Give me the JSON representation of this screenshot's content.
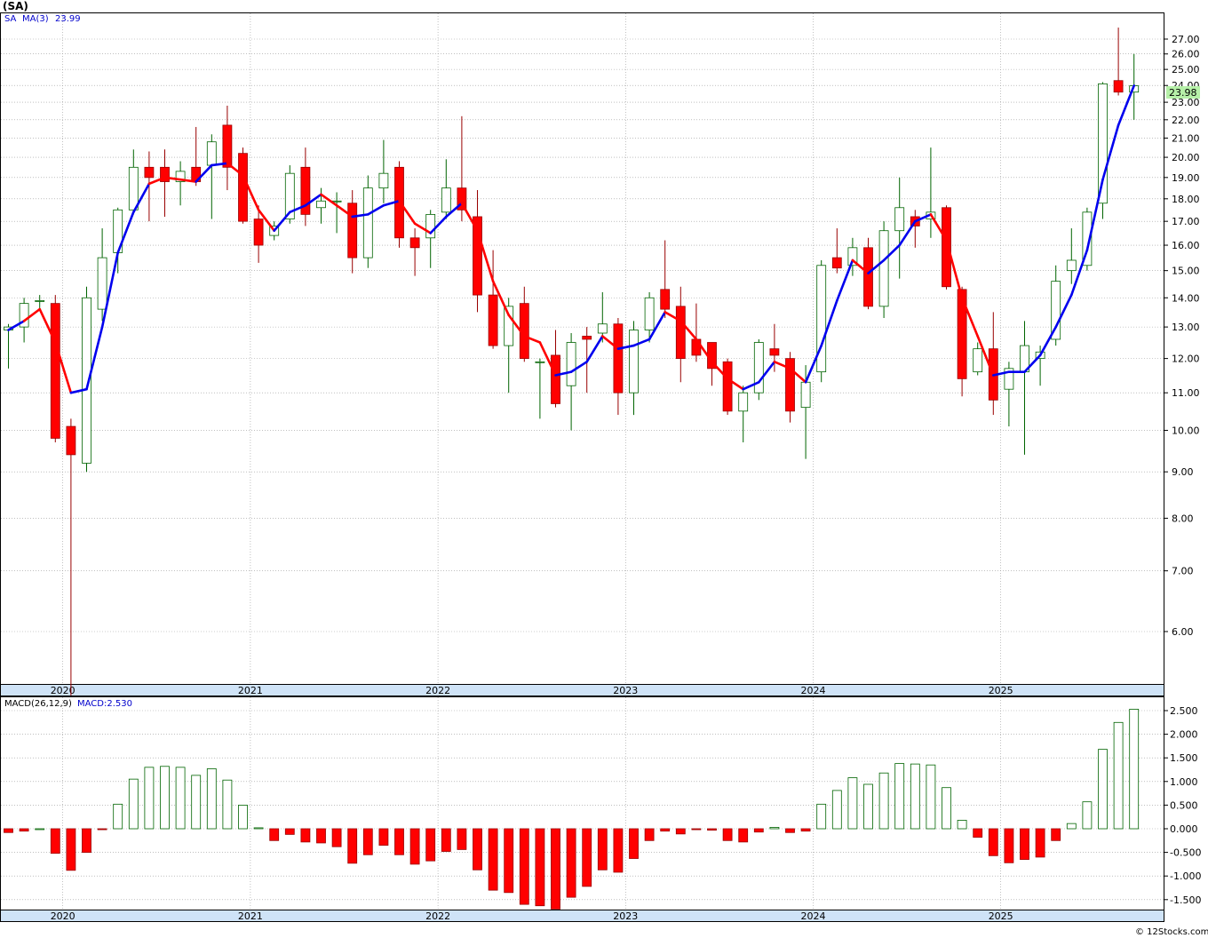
{
  "chart_title": "(SA)",
  "price_legend": {
    "symbol": "SA",
    "ma_label": "MA(3)",
    "ma_value": "23.99"
  },
  "last_price_label": "23.98",
  "macd_legend": {
    "label": "MACD(26,12,9)",
    "value_label": "MACD:2.530"
  },
  "footer": "© 12Stocks.com",
  "colors": {
    "up": "#006400",
    "down": "#ff0000",
    "ma_up": "#0000ee",
    "ma_down": "#ff0000",
    "axis_band": "#cfe3f7",
    "last_price_bg": "#b6f0a8",
    "grid": "#999999"
  },
  "chart_data": [
    {
      "type": "candlestick",
      "ylabel": "",
      "y_scale": "log",
      "y_ticks": [
        "6.00",
        "7.00",
        "8.00",
        "9.00",
        "10.00",
        "11.00",
        "12.00",
        "13.00",
        "14.00",
        "15.00",
        "16.00",
        "17.00",
        "18.00",
        "19.00",
        "20.00",
        "21.00",
        "22.00",
        "23.00",
        "24.00",
        "25.00",
        "26.00",
        "27.00"
      ],
      "x_ticks": [
        "2020",
        "2021",
        "2022",
        "2023",
        "2024",
        "2025"
      ],
      "candles": [
        {
          "o": 12.9,
          "h": 13.1,
          "l": 11.7,
          "c": 13.0
        },
        {
          "o": 13.0,
          "h": 14.0,
          "l": 12.5,
          "c": 13.8
        },
        {
          "o": 13.9,
          "h": 14.1,
          "l": 13.6,
          "c": 13.9
        },
        {
          "o": 13.8,
          "h": 14.1,
          "l": 9.7,
          "c": 9.8
        },
        {
          "o": 10.1,
          "h": 10.3,
          "l": 5.1,
          "c": 9.4
        },
        {
          "o": 9.2,
          "h": 14.4,
          "l": 9.0,
          "c": 14.0
        },
        {
          "o": 13.6,
          "h": 16.7,
          "l": 13.2,
          "c": 15.5
        },
        {
          "o": 15.7,
          "h": 17.6,
          "l": 14.9,
          "c": 17.5
        },
        {
          "o": 17.5,
          "h": 20.4,
          "l": 17.3,
          "c": 19.5
        },
        {
          "o": 19.5,
          "h": 20.3,
          "l": 17.0,
          "c": 19.0
        },
        {
          "o": 19.5,
          "h": 20.4,
          "l": 17.2,
          "c": 18.8
        },
        {
          "o": 18.8,
          "h": 19.8,
          "l": 17.7,
          "c": 19.3
        },
        {
          "o": 19.5,
          "h": 21.6,
          "l": 18.6,
          "c": 18.8
        },
        {
          "o": 19.6,
          "h": 21.2,
          "l": 17.1,
          "c": 20.8
        },
        {
          "o": 21.7,
          "h": 22.8,
          "l": 18.4,
          "c": 19.5
        },
        {
          "o": 20.2,
          "h": 20.5,
          "l": 16.9,
          "c": 17.0
        },
        {
          "o": 17.1,
          "h": 17.7,
          "l": 15.3,
          "c": 16.0
        },
        {
          "o": 16.4,
          "h": 17.0,
          "l": 16.2,
          "c": 16.8
        },
        {
          "o": 17.1,
          "h": 19.6,
          "l": 16.9,
          "c": 19.2
        },
        {
          "o": 19.5,
          "h": 20.5,
          "l": 16.8,
          "c": 17.3
        },
        {
          "o": 17.6,
          "h": 18.5,
          "l": 16.9,
          "c": 17.9
        },
        {
          "o": 17.9,
          "h": 18.3,
          "l": 16.5,
          "c": 17.9
        },
        {
          "o": 17.8,
          "h": 18.4,
          "l": 14.9,
          "c": 15.5
        },
        {
          "o": 15.5,
          "h": 19.1,
          "l": 15.1,
          "c": 18.5
        },
        {
          "o": 18.5,
          "h": 20.9,
          "l": 17.8,
          "c": 19.2
        },
        {
          "o": 19.5,
          "h": 19.8,
          "l": 15.9,
          "c": 16.3
        },
        {
          "o": 16.3,
          "h": 16.7,
          "l": 14.8,
          "c": 15.9
        },
        {
          "o": 16.3,
          "h": 17.5,
          "l": 15.1,
          "c": 17.3
        },
        {
          "o": 17.4,
          "h": 19.9,
          "l": 17.1,
          "c": 18.5
        },
        {
          "o": 18.5,
          "h": 22.2,
          "l": 17.0,
          "c": 17.5
        },
        {
          "o": 17.2,
          "h": 18.4,
          "l": 13.5,
          "c": 14.1
        },
        {
          "o": 14.1,
          "h": 15.8,
          "l": 12.3,
          "c": 12.4
        },
        {
          "o": 12.4,
          "h": 14.0,
          "l": 11.0,
          "c": 13.7
        },
        {
          "o": 13.8,
          "h": 14.4,
          "l": 11.9,
          "c": 12.0
        },
        {
          "o": 11.9,
          "h": 12.0,
          "l": 10.3,
          "c": 11.9
        },
        {
          "o": 12.1,
          "h": 12.9,
          "l": 10.6,
          "c": 10.7
        },
        {
          "o": 11.2,
          "h": 12.8,
          "l": 10.0,
          "c": 12.5
        },
        {
          "o": 12.7,
          "h": 13.0,
          "l": 11.0,
          "c": 12.6
        },
        {
          "o": 12.8,
          "h": 14.2,
          "l": 12.5,
          "c": 13.1
        },
        {
          "o": 13.1,
          "h": 13.3,
          "l": 10.4,
          "c": 11.0
        },
        {
          "o": 11.0,
          "h": 13.2,
          "l": 10.4,
          "c": 12.9
        },
        {
          "o": 12.9,
          "h": 14.2,
          "l": 12.5,
          "c": 14.0
        },
        {
          "o": 14.3,
          "h": 16.2,
          "l": 13.3,
          "c": 13.6
        },
        {
          "o": 13.7,
          "h": 14.4,
          "l": 11.3,
          "c": 12.0
        },
        {
          "o": 12.6,
          "h": 13.8,
          "l": 11.9,
          "c": 12.1
        },
        {
          "o": 12.5,
          "h": 12.5,
          "l": 11.2,
          "c": 11.7
        },
        {
          "o": 11.9,
          "h": 12.0,
          "l": 10.4,
          "c": 10.5
        },
        {
          "o": 10.5,
          "h": 11.2,
          "l": 9.7,
          "c": 11.0
        },
        {
          "o": 11.0,
          "h": 12.6,
          "l": 10.8,
          "c": 12.5
        },
        {
          "o": 12.3,
          "h": 13.1,
          "l": 11.6,
          "c": 12.1
        },
        {
          "o": 12.0,
          "h": 12.2,
          "l": 10.2,
          "c": 10.5
        },
        {
          "o": 10.6,
          "h": 11.8,
          "l": 9.3,
          "c": 11.3
        },
        {
          "o": 11.6,
          "h": 15.4,
          "l": 11.3,
          "c": 15.2
        },
        {
          "o": 15.5,
          "h": 16.7,
          "l": 14.9,
          "c": 15.1
        },
        {
          "o": 15.2,
          "h": 16.3,
          "l": 14.8,
          "c": 15.9
        },
        {
          "o": 15.9,
          "h": 16.3,
          "l": 13.6,
          "c": 13.7
        },
        {
          "o": 13.7,
          "h": 17.0,
          "l": 13.3,
          "c": 16.6
        },
        {
          "o": 16.6,
          "h": 19.0,
          "l": 14.7,
          "c": 17.6
        },
        {
          "o": 17.2,
          "h": 17.5,
          "l": 15.9,
          "c": 16.8
        },
        {
          "o": 17.1,
          "h": 20.5,
          "l": 16.3,
          "c": 17.4
        },
        {
          "o": 17.6,
          "h": 17.7,
          "l": 14.3,
          "c": 14.4
        },
        {
          "o": 14.3,
          "h": 14.4,
          "l": 10.9,
          "c": 11.4
        },
        {
          "o": 11.6,
          "h": 12.5,
          "l": 11.5,
          "c": 12.3
        },
        {
          "o": 12.3,
          "h": 13.5,
          "l": 10.4,
          "c": 10.8
        },
        {
          "o": 11.1,
          "h": 11.9,
          "l": 10.1,
          "c": 11.7
        },
        {
          "o": 11.6,
          "h": 13.2,
          "l": 9.4,
          "c": 12.4
        },
        {
          "o": 12.0,
          "h": 12.4,
          "l": 11.2,
          "c": 12.2
        },
        {
          "o": 12.6,
          "h": 15.2,
          "l": 12.4,
          "c": 14.6
        },
        {
          "o": 15.0,
          "h": 16.7,
          "l": 14.5,
          "c": 15.4
        },
        {
          "o": 15.2,
          "h": 17.6,
          "l": 15.0,
          "c": 17.4
        },
        {
          "o": 17.8,
          "h": 24.2,
          "l": 17.1,
          "c": 24.1
        },
        {
          "o": 24.3,
          "h": 27.8,
          "l": 23.4,
          "c": 23.6
        },
        {
          "o": 23.6,
          "h": 26.0,
          "l": 22.0,
          "c": 23.98
        }
      ],
      "moving_average": [
        12.9,
        13.2,
        13.6,
        12.5,
        11.0,
        11.1,
        13.0,
        15.7,
        17.4,
        18.7,
        19.0,
        18.9,
        18.8,
        19.6,
        19.7,
        19.1,
        17.5,
        16.6,
        17.4,
        17.7,
        18.2,
        17.7,
        17.2,
        17.3,
        17.7,
        17.9,
        16.9,
        16.5,
        17.2,
        17.8,
        16.6,
        14.6,
        13.4,
        12.7,
        12.5,
        11.5,
        11.6,
        11.9,
        12.7,
        12.3,
        12.4,
        12.6,
        13.5,
        13.2,
        12.6,
        11.9,
        11.4,
        11.1,
        11.3,
        11.9,
        11.7,
        11.3,
        12.4,
        13.9,
        15.4,
        14.9,
        15.4,
        16.0,
        17.0,
        17.3,
        16.2,
        14.0,
        12.7,
        11.5,
        11.6,
        11.6,
        12.1,
        13.0,
        14.1,
        15.8,
        18.9,
        21.7,
        23.99
      ],
      "ma_colors": [
        "b",
        "b",
        "r",
        "r",
        "r",
        "b",
        "b",
        "b",
        "b",
        "b",
        "r",
        "r",
        "r",
        "b",
        "b",
        "r",
        "r",
        "r",
        "b",
        "b",
        "b",
        "r",
        "r",
        "b",
        "b",
        "b",
        "r",
        "r",
        "b",
        "b",
        "r",
        "r",
        "r",
        "r",
        "r",
        "r",
        "b",
        "b",
        "b",
        "r",
        "b",
        "b",
        "b",
        "r",
        "r",
        "r",
        "r",
        "r",
        "b",
        "b",
        "r",
        "r",
        "b",
        "b",
        "b",
        "r",
        "b",
        "b",
        "b",
        "b",
        "r",
        "r",
        "r",
        "r",
        "b",
        "b",
        "b",
        "b",
        "b",
        "b",
        "b",
        "b",
        "b"
      ]
    },
    {
      "type": "bar",
      "name": "MACD",
      "ylim": [
        -1.75,
        2.75
      ],
      "y_ticks": [
        "-1.500",
        "-1.000",
        "-0.500",
        "0.000",
        "0.500",
        "1.000",
        "1.500",
        "2.000",
        "2.500"
      ],
      "x_ticks": [
        "2020",
        "2021",
        "2022",
        "2023",
        "2024",
        "2025"
      ],
      "values": [
        -0.08,
        -0.05,
        0,
        -0.52,
        -0.88,
        -0.5,
        -0.02,
        0.52,
        1.05,
        1.3,
        1.32,
        1.3,
        1.13,
        1.27,
        1.03,
        0.5,
        0.02,
        -0.25,
        -0.12,
        -0.28,
        -0.3,
        -0.38,
        -0.73,
        -0.55,
        -0.35,
        -0.55,
        -0.75,
        -0.68,
        -0.48,
        -0.44,
        -0.87,
        -1.3,
        -1.35,
        -1.6,
        -1.63,
        -1.7,
        -1.45,
        -1.22,
        -0.87,
        -0.92,
        -0.63,
        -0.25,
        -0.05,
        -0.11,
        -0.02,
        -0.03,
        -0.25,
        -0.28,
        -0.07,
        0.03,
        -0.08,
        -0.05,
        0.52,
        0.81,
        1.08,
        0.94,
        1.18,
        1.38,
        1.37,
        1.35,
        0.87,
        0.18,
        -0.18,
        -0.57,
        -0.72,
        -0.65,
        -0.6,
        -0.25,
        0.11,
        0.57,
        1.68,
        2.25,
        2.53
      ]
    }
  ]
}
